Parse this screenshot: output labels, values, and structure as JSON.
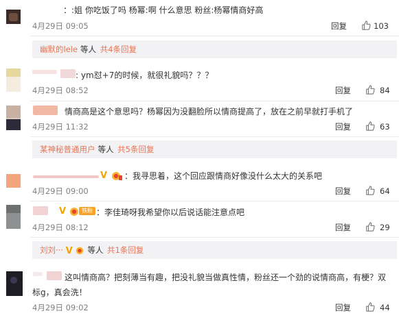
{
  "comments": [
    {
      "text": "：:姐 你吃饭了吗  杨幂:啊 什么意思  粉丝:杨幂情商好高",
      "date": "4月29日 09:05",
      "reply": "回复",
      "likes": "103"
    },
    {
      "text": ":  ym怼+7的时候，就很礼貌吗？？？",
      "date": "4月29日 08:52",
      "reply": "回复",
      "likes": "84"
    },
    {
      "text": "情商高是这个意思吗？杨幂因为没翻脸所以情商提高了，放在之前早就打手机了",
      "date": "4月29日 11:32",
      "reply": "回复",
      "likes": "63"
    },
    {
      "text": "：我寻思着，这个回应跟情商好像没什么太大的关系吧",
      "date": "4月29日 09:00",
      "reply": "回复",
      "likes": "64"
    },
    {
      "text": "：李佳琦呀我希望你以后说话能注意点吧",
      "date": "4月29日 08:12",
      "reply": "回复",
      "likes": "29",
      "fan_badge": "铁粉"
    },
    {
      "text_line1": "这叫情商高？把刻薄当有趣，把没礼貌当做真性情，粉丝还一个劲的说情商高，有梗？双",
      "text_line2": "标g，真会洗！",
      "date": "4月29日 09:02",
      "reply": "回复",
      "likes": "44"
    }
  ],
  "subreplies": [
    {
      "who": "幽默的lele",
      "mid": "等人",
      "count": "共4条回复"
    },
    {
      "who": "某神秘普通用户",
      "mid": "等人",
      "count": "共5条回复"
    },
    {
      "who": "刘刘···",
      "mid": "等人",
      "count": "共1条回复"
    }
  ],
  "colors": {
    "accent": "#eb7350",
    "text": "#333333",
    "meta": "#808080",
    "subbg": "#f2f2f5"
  }
}
